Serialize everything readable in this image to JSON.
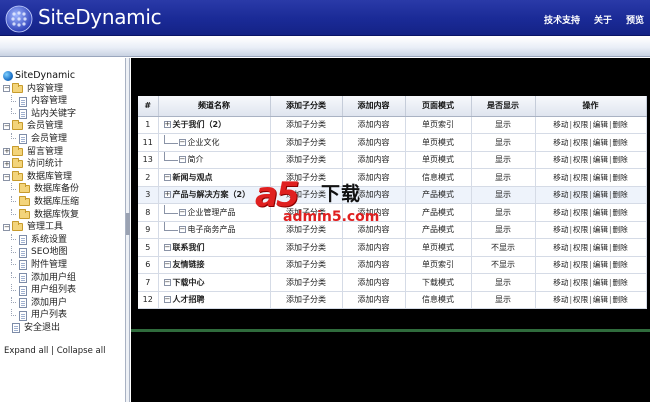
{
  "app": {
    "brand": "SiteDynamic",
    "top_nav": [
      "技术支持",
      "关于",
      "预览"
    ]
  },
  "sidebar": {
    "root": "SiteDynamic",
    "tree": [
      {
        "label": "内容管理",
        "type": "folder",
        "level": 1,
        "expanded": true
      },
      {
        "label": "内容管理",
        "type": "page",
        "level": 2
      },
      {
        "label": "站内关键字",
        "type": "page",
        "level": 2
      },
      {
        "label": "会员管理",
        "type": "folder",
        "level": 1,
        "expanded": true
      },
      {
        "label": "会员管理",
        "type": "page",
        "level": 2
      },
      {
        "label": "留言管理",
        "type": "folder",
        "level": 1,
        "expanded": false
      },
      {
        "label": "访问统计",
        "type": "folder",
        "level": 1,
        "expanded": false
      },
      {
        "label": "数据库管理",
        "type": "folder",
        "level": 1,
        "expanded": true
      },
      {
        "label": "数据库备份",
        "type": "folder",
        "level": 2
      },
      {
        "label": "数据库压缩",
        "type": "folder",
        "level": 2
      },
      {
        "label": "数据库恢复",
        "type": "folder",
        "level": 2
      },
      {
        "label": "管理工具",
        "type": "folder",
        "level": 1,
        "expanded": true
      },
      {
        "label": "系统设置",
        "type": "page",
        "level": 2
      },
      {
        "label": "SEO地图",
        "type": "page",
        "level": 2
      },
      {
        "label": "附件管理",
        "type": "page",
        "level": 2
      },
      {
        "label": "添加用户组",
        "type": "page",
        "level": 2
      },
      {
        "label": "用户组列表",
        "type": "page",
        "level": 2
      },
      {
        "label": "添加用户",
        "type": "page",
        "level": 2
      },
      {
        "label": "用户列表",
        "type": "page",
        "level": 2
      },
      {
        "label": "安全退出",
        "type": "page",
        "level": 1
      }
    ],
    "expand_all": "Expand all",
    "separator": "|",
    "collapse_all": "Collapse all"
  },
  "table": {
    "headers": [
      "#",
      "频道名称",
      "添加子分类",
      "添加内容",
      "页面模式",
      "是否显示",
      "操作"
    ],
    "op_labels": [
      "移动",
      "权限",
      "编辑",
      "删除"
    ],
    "op_sep": "|",
    "rows": [
      {
        "id": "1",
        "name": "关于我们（2）",
        "kind": "parent",
        "add_sub": "添加子分类",
        "add_content": "添加内容",
        "mode": "单页索引",
        "show": "显示"
      },
      {
        "id": "11",
        "name": "企业文化",
        "kind": "child",
        "add_sub": "添加子分类",
        "add_content": "添加内容",
        "mode": "单页模式",
        "show": "显示"
      },
      {
        "id": "13",
        "name": "简介",
        "kind": "child",
        "add_sub": "添加子分类",
        "add_content": "添加内容",
        "mode": "单页模式",
        "show": "显示"
      },
      {
        "id": "2",
        "name": "新闻与观点",
        "kind": "leaf",
        "add_sub": "添加子分类",
        "add_content": "添加内容",
        "mode": "信息模式",
        "show": "显示"
      },
      {
        "id": "3",
        "name": "产品与解决方案（2）",
        "kind": "parent",
        "add_sub": "添加子分类",
        "add_content": "添加内容",
        "mode": "产品模式",
        "show": "显示",
        "selected": true
      },
      {
        "id": "8",
        "name": "企业管理产品",
        "kind": "child",
        "add_sub": "添加子分类",
        "add_content": "添加内容",
        "mode": "产品模式",
        "show": "显示"
      },
      {
        "id": "9",
        "name": "电子商务产品",
        "kind": "child",
        "add_sub": "添加子分类",
        "add_content": "添加内容",
        "mode": "产品模式",
        "show": "显示"
      },
      {
        "id": "5",
        "name": "联系我们",
        "kind": "leaf",
        "add_sub": "添加子分类",
        "add_content": "添加内容",
        "mode": "单页模式",
        "show": "不显示"
      },
      {
        "id": "6",
        "name": "友情链接",
        "kind": "leaf",
        "add_sub": "添加子分类",
        "add_content": "添加内容",
        "mode": "单页索引",
        "show": "不显示"
      },
      {
        "id": "7",
        "name": "下载中心",
        "kind": "leaf",
        "add_sub": "添加子分类",
        "add_content": "添加内容",
        "mode": "下载模式",
        "show": "显示"
      },
      {
        "id": "12",
        "name": "人才招聘",
        "kind": "leaf",
        "add_sub": "添加子分类",
        "add_content": "添加内容",
        "mode": "信息模式",
        "show": "显示"
      }
    ]
  },
  "watermark": {
    "mark": "a5",
    "text": "下载",
    "url": "admin5.com"
  }
}
